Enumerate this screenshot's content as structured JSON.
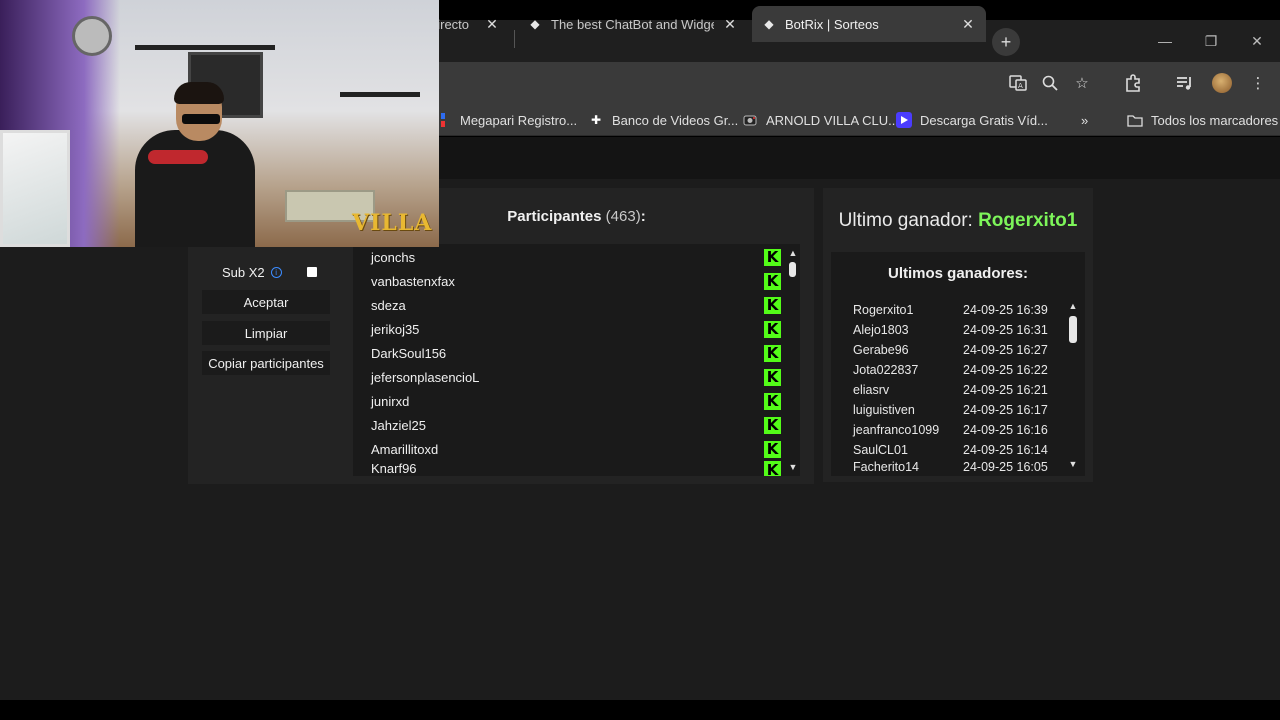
{
  "browser": {
    "tabs": [
      {
        "title": "directo",
        "active": false
      },
      {
        "title": "The best ChatBot and Widgets",
        "active": false
      },
      {
        "title": "BotRix | Sorteos",
        "active": true
      }
    ],
    "new_tab": "+",
    "window_controls": {
      "minimize": "—",
      "restore": "❐",
      "close": "✕"
    },
    "toolbar_icons": [
      "translate-icon",
      "zoom-icon",
      "star-icon",
      "extensions-icon",
      "media-icon",
      "profile-avatar",
      "menu-icon"
    ],
    "bookmarks": [
      {
        "label": "Megapari Registro...",
        "icon": "megapari-icon"
      },
      {
        "label": "Banco de Videos Gr...",
        "icon": "plus-logo-icon"
      },
      {
        "label": "ARNOLD VILLA CLU...",
        "icon": "camera-icon"
      },
      {
        "label": "Descarga Gratis Víd...",
        "icon": "play-logo-icon"
      }
    ],
    "bookmarks_overflow": "»",
    "all_bookmarks": "Todos los marcadores"
  },
  "sidebar": {
    "sub_x2_label": "Sub X2",
    "sub_x2_checked": false,
    "buttons": [
      "Aceptar",
      "Limpiar",
      "Copiar participantes"
    ]
  },
  "participants": {
    "title": "Participantes",
    "count": "(463)",
    "colon": ":",
    "list": [
      "jconchs",
      "vanbastenxfax",
      "sdeza",
      "jerikoj35",
      "DarkSoul156",
      "jefersonplasencioL",
      "junirxd",
      "Jahziel25",
      "Amarillitoxd",
      "Knarf96"
    ],
    "platform_badge": "K",
    "badge_color": "#53fc18"
  },
  "winners": {
    "last_winner_label": "Ultimo ganador:",
    "last_winner": "Rogerxito1",
    "history_title": "Ultimos ganadores:",
    "history": [
      {
        "name": "Rogerxito1",
        "time": "24-09-25 16:39"
      },
      {
        "name": "Alejo1803",
        "time": "24-09-25 16:31"
      },
      {
        "name": "Gerabe96",
        "time": "24-09-25 16:27"
      },
      {
        "name": "Jota022837",
        "time": "24-09-25 16:22"
      },
      {
        "name": "eliasrv",
        "time": "24-09-25 16:21"
      },
      {
        "name": "luiguistiven",
        "time": "24-09-25 16:17"
      },
      {
        "name": "jeanfranco1099",
        "time": "24-09-25 16:16"
      },
      {
        "name": "SaulCL01",
        "time": "24-09-25 16:14"
      },
      {
        "name": "Facherito14",
        "time": "24-09-25 16:05"
      }
    ],
    "winner_color": "#7df55a"
  },
  "webcam": {
    "overlay_text": "VILLA"
  }
}
